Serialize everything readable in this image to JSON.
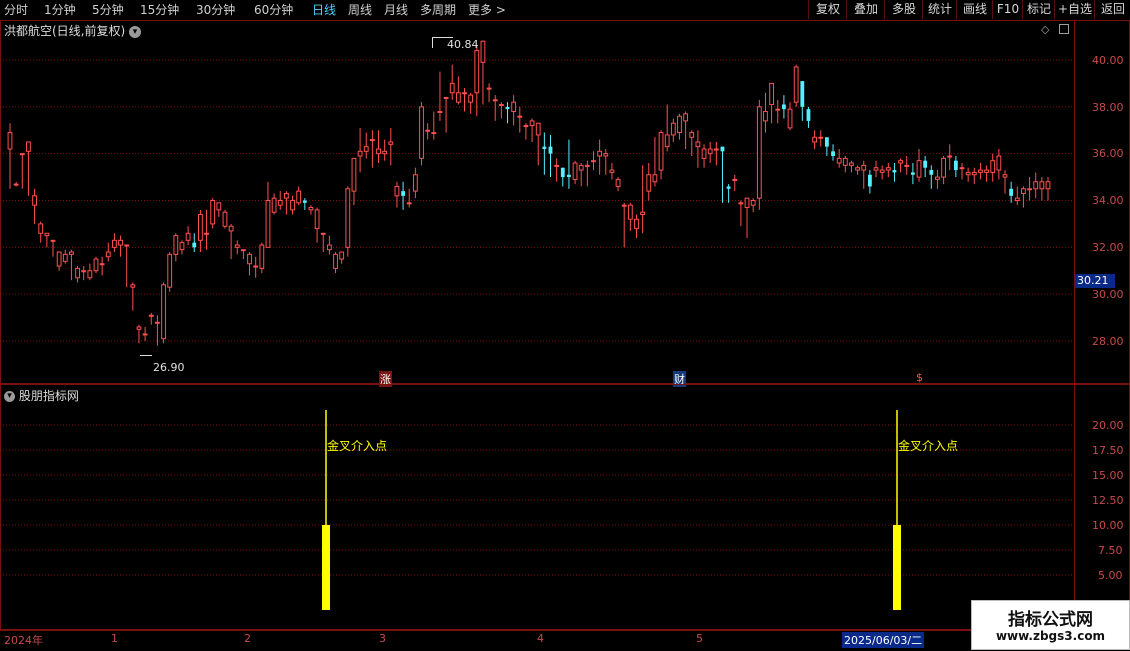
{
  "toolbar": {
    "periods": [
      "分时",
      "1分钟",
      "5分钟",
      "15分钟",
      "30分钟",
      "60分钟",
      "日线",
      "周线",
      "月线",
      "多周期",
      "更多 >"
    ],
    "active_period": "日线",
    "buttons": [
      "复权",
      "叠加",
      "多股",
      "统计",
      "画线",
      "F10",
      "标记",
      "+自选",
      "返回"
    ]
  },
  "main_panel": {
    "title": "洪都航空(日线,前复权)",
    "y_ticks": [
      "40.00",
      "38.00",
      "36.00",
      "34.00",
      "32.00",
      "30.00",
      "28.00"
    ],
    "high_label": "40.84",
    "low_label": "26.90",
    "current_price": "30.21",
    "event_marks": [
      "涨",
      "财",
      "$"
    ]
  },
  "indicator_panel": {
    "title": "股朋指标网",
    "y_ticks": [
      "20.00",
      "17.50",
      "15.00",
      "12.50",
      "10.00",
      "7.50",
      "5.00"
    ],
    "signal_label": "金叉介入点",
    "signals": [
      {
        "label": "金叉介入点"
      },
      {
        "label": "金叉介入点"
      }
    ]
  },
  "x_axis": {
    "labels": [
      "2024年",
      "1",
      "2",
      "3",
      "4",
      "5",
      "6"
    ],
    "cursor_date": "2025/06/03/二"
  },
  "watermark": {
    "title": "指标公式网",
    "url": "www.zbgs3.com"
  },
  "colors": {
    "up": "#ff5050",
    "down": "#54f0ff",
    "signal": "#ffff00",
    "grid": "#7a1010"
  },
  "chart_data": {
    "type": "candlestick",
    "title": "洪都航空(日线,前复权)",
    "ylim": [
      27.0,
      41.0
    ],
    "y_ticks": [
      28,
      30,
      32,
      34,
      36,
      38,
      40
    ],
    "high": 40.84,
    "low": 26.9,
    "last": 30.21,
    "candles": [
      [
        36.2,
        36.9,
        36.0,
        37.3,
        34.5
      ],
      [
        34.7,
        34.7,
        34.5,
        34.8,
        34.6
      ],
      [
        36.0,
        36.0,
        34.5,
        36.0,
        34.5
      ],
      [
        36.1,
        36.5,
        35.6,
        36.5,
        34.2
      ],
      [
        33.8,
        34.2,
        33.2,
        34.5,
        33.0
      ],
      [
        32.6,
        33.0,
        32.3,
        33.1,
        32.2
      ],
      [
        32.5,
        32.6,
        32.3,
        32.6,
        32.0
      ],
      [
        32.3,
        32.3,
        31.7,
        32.3,
        31.6
      ],
      [
        31.2,
        31.8,
        31.1,
        31.8,
        31.0
      ],
      [
        31.4,
        31.7,
        31.4,
        31.9,
        31.3
      ],
      [
        31.7,
        31.8,
        30.6,
        31.9,
        30.6
      ],
      [
        30.7,
        31.1,
        30.7,
        31.2,
        30.5
      ],
      [
        31.0,
        31.0,
        30.7,
        31.2,
        30.6
      ],
      [
        30.7,
        31.0,
        30.7,
        31.3,
        30.6
      ],
      [
        31.0,
        31.5,
        31.0,
        31.6,
        30.9
      ],
      [
        31.3,
        31.3,
        31.0,
        31.6,
        30.8
      ],
      [
        31.6,
        31.8,
        31.6,
        32.2,
        31.4
      ],
      [
        32.0,
        32.3,
        32.0,
        32.6,
        31.8
      ],
      [
        32.1,
        32.3,
        31.7,
        32.5,
        31.6
      ],
      [
        32.1,
        32.1,
        30.6,
        32.1,
        30.3
      ],
      [
        30.3,
        30.4,
        29.3,
        30.5,
        29.3
      ],
      [
        28.5,
        28.6,
        28.1,
        28.7,
        27.9
      ],
      [
        28.3,
        28.3,
        28.1,
        28.6,
        28.0
      ],
      [
        29.1,
        29.1,
        28.8,
        29.2,
        28.7
      ],
      [
        28.8,
        28.8,
        28.1,
        29.1,
        27.8
      ],
      [
        28.1,
        30.4,
        28.0,
        30.5,
        27.9
      ],
      [
        30.3,
        31.7,
        30.3,
        31.8,
        30.1
      ],
      [
        31.7,
        32.5,
        31.7,
        32.6,
        31.4
      ],
      [
        31.9,
        32.2,
        31.9,
        32.3,
        31.7
      ],
      [
        32.3,
        32.6,
        32.3,
        32.9,
        32.1
      ],
      [
        32.2,
        32.0,
        31.8,
        32.6,
        31.8
      ],
      [
        32.3,
        33.4,
        32.2,
        33.6,
        31.8
      ],
      [
        32.6,
        32.6,
        31.9,
        33.6,
        31.9
      ],
      [
        33.0,
        34.0,
        33.0,
        34.1,
        32.8
      ],
      [
        33.6,
        33.9,
        33.4,
        33.9,
        33.3
      ],
      [
        32.9,
        33.5,
        32.9,
        33.6,
        32.8
      ],
      [
        32.7,
        32.9,
        31.9,
        33.0,
        31.5
      ],
      [
        32.0,
        32.1,
        31.8,
        32.3,
        31.7
      ],
      [
        31.9,
        31.9,
        31.6,
        31.9,
        31.5
      ],
      [
        31.3,
        31.7,
        31.1,
        31.8,
        30.8
      ],
      [
        31.2,
        31.2,
        30.8,
        31.6,
        30.7
      ],
      [
        31.1,
        32.1,
        30.9,
        32.2,
        30.9
      ],
      [
        32.0,
        34.0,
        32.0,
        34.8,
        32.0
      ],
      [
        33.5,
        34.1,
        33.5,
        34.3,
        33.4
      ],
      [
        33.8,
        34.0,
        33.8,
        34.4,
        33.6
      ],
      [
        34.1,
        34.3,
        33.4,
        34.4,
        33.4
      ],
      [
        33.6,
        34.0,
        33.6,
        34.2,
        33.4
      ],
      [
        33.9,
        34.4,
        33.8,
        34.6,
        33.8
      ],
      [
        34.0,
        33.9,
        33.8,
        34.1,
        33.6
      ],
      [
        33.6,
        33.7,
        33.5,
        33.8,
        33.4
      ],
      [
        32.8,
        33.6,
        32.4,
        33.7,
        32.2
      ],
      [
        32.6,
        32.6,
        31.9,
        32.6,
        31.8
      ],
      [
        31.9,
        32.1,
        31.8,
        32.5,
        31.7
      ],
      [
        31.1,
        31.7,
        31.1,
        31.8,
        30.9
      ],
      [
        31.5,
        31.8,
        31.4,
        31.8,
        31.3
      ],
      [
        32.0,
        34.5,
        31.9,
        34.6,
        31.6
      ],
      [
        34.4,
        35.8,
        34.0,
        35.8,
        33.8
      ],
      [
        35.9,
        36.1,
        35.9,
        37.1,
        35.2
      ],
      [
        36.1,
        36.3,
        36.1,
        36.9,
        35.8
      ],
      [
        36.6,
        36.6,
        35.6,
        37.0,
        35.4
      ],
      [
        36.0,
        36.2,
        35.9,
        37.0,
        35.6
      ],
      [
        36.0,
        36.1,
        35.9,
        36.6,
        35.7
      ],
      [
        36.4,
        36.5,
        35.6,
        37.1,
        35.5
      ],
      [
        34.2,
        34.6,
        34.2,
        34.8,
        33.7
      ],
      [
        34.4,
        34.2,
        33.7,
        34.8,
        33.6
      ],
      [
        33.9,
        33.9,
        33.9,
        34.5,
        33.7
      ],
      [
        34.4,
        35.1,
        34.2,
        35.4,
        34.1
      ],
      [
        35.8,
        38.0,
        35.8,
        38.2,
        35.5
      ],
      [
        37.0,
        37.0,
        36.9,
        37.3,
        36.6
      ],
      [
        36.9,
        36.9,
        36.6,
        37.8,
        36.6
      ],
      [
        37.8,
        37.8,
        37.5,
        39.5,
        37.4
      ],
      [
        38.4,
        38.4,
        37.0,
        38.4,
        36.9
      ],
      [
        38.6,
        39.0,
        38.6,
        39.8,
        38.3
      ],
      [
        38.2,
        38.6,
        38.2,
        39.3,
        38.1
      ],
      [
        38.6,
        38.6,
        37.8,
        38.8,
        37.8
      ],
      [
        38.2,
        38.5,
        38.1,
        38.6,
        37.7
      ],
      [
        38.6,
        40.4,
        38.5,
        40.6,
        37.6
      ],
      [
        39.9,
        40.8,
        38.6,
        40.84,
        38.1
      ],
      [
        38.8,
        38.8,
        38.5,
        39.0,
        38.2
      ],
      [
        38.3,
        38.3,
        37.8,
        38.5,
        37.4
      ],
      [
        38.1,
        38.1,
        37.9,
        38.2,
        37.5
      ],
      [
        38.0,
        37.9,
        37.4,
        38.2,
        37.3
      ],
      [
        37.8,
        38.2,
        37.6,
        38.5,
        37.2
      ],
      [
        37.6,
        37.6,
        37.1,
        38.0,
        36.9
      ],
      [
        37.2,
        37.2,
        36.7,
        37.3,
        36.6
      ],
      [
        37.2,
        37.4,
        36.9,
        37.5,
        36.5
      ],
      [
        36.8,
        37.3,
        36.6,
        37.3,
        35.5
      ],
      [
        36.3,
        36.2,
        36.0,
        36.9,
        35.1
      ],
      [
        36.3,
        36.0,
        35.1,
        36.8,
        35.0
      ],
      [
        35.5,
        35.5,
        35.0,
        35.8,
        34.8
      ],
      [
        35.4,
        35.0,
        34.8,
        35.4,
        34.6
      ],
      [
        35.1,
        35.0,
        34.7,
        36.6,
        34.5
      ],
      [
        34.9,
        35.6,
        34.7,
        35.7,
        34.7
      ],
      [
        35.3,
        35.5,
        34.8,
        35.6,
        34.6
      ],
      [
        35.5,
        35.5,
        34.8,
        35.7,
        34.6
      ],
      [
        35.7,
        35.7,
        35.4,
        36.1,
        35.3
      ],
      [
        35.9,
        36.1,
        35.8,
        36.6,
        35.1
      ],
      [
        35.9,
        36.0,
        35.5,
        36.2,
        35.1
      ],
      [
        35.2,
        35.3,
        35.1,
        35.6,
        34.9
      ],
      [
        34.6,
        34.9,
        34.5,
        35.0,
        34.4
      ],
      [
        33.8,
        33.8,
        32.4,
        33.9,
        32.0
      ],
      [
        33.2,
        33.8,
        32.9,
        33.9,
        32.7
      ],
      [
        32.8,
        33.2,
        32.6,
        33.4,
        32.4
      ],
      [
        33.4,
        33.5,
        33.2,
        35.5,
        32.6
      ],
      [
        34.4,
        35.1,
        34.3,
        35.6,
        34.0
      ],
      [
        34.8,
        35.1,
        34.8,
        36.7,
        34.6
      ],
      [
        35.3,
        36.9,
        35.3,
        37.0,
        34.9
      ],
      [
        36.3,
        36.8,
        36.2,
        38.1,
        36.1
      ],
      [
        36.8,
        37.3,
        36.7,
        37.5,
        36.5
      ],
      [
        36.9,
        37.6,
        36.8,
        37.7,
        36.6
      ],
      [
        37.4,
        37.7,
        36.9,
        37.8,
        36.2
      ],
      [
        36.7,
        36.9,
        36.4,
        37.0,
        35.9
      ],
      [
        36.3,
        36.5,
        35.6,
        37.0,
        35.4
      ],
      [
        35.8,
        36.2,
        35.8,
        36.4,
        35.4
      ],
      [
        36.0,
        36.2,
        35.9,
        36.5,
        35.6
      ],
      [
        36.2,
        36.2,
        35.6,
        36.5,
        35.5
      ],
      [
        36.3,
        36.1,
        34.0,
        36.3,
        33.9
      ],
      [
        34.6,
        34.5,
        34.2,
        34.7,
        33.9
      ],
      [
        34.9,
        34.9,
        34.6,
        35.1,
        34.4
      ],
      [
        33.9,
        33.9,
        33.0,
        34.0,
        32.9
      ],
      [
        33.7,
        34.1,
        33.6,
        34.1,
        32.4
      ],
      [
        33.8,
        34.0,
        33.7,
        34.1,
        33.5
      ],
      [
        34.1,
        38.0,
        34.1,
        38.3,
        33.6
      ],
      [
        37.4,
        37.8,
        37.1,
        38.6,
        36.9
      ],
      [
        38.1,
        39.0,
        37.6,
        39.0,
        37.3
      ],
      [
        37.9,
        37.9,
        37.8,
        38.3,
        37.3
      ],
      [
        38.1,
        37.9,
        37.6,
        38.5,
        37.5
      ],
      [
        37.1,
        37.9,
        37.1,
        38.2,
        37.0
      ],
      [
        38.2,
        39.7,
        38.1,
        39.8,
        38.0
      ],
      [
        39.1,
        38.0,
        37.5,
        39.1,
        37.4
      ],
      [
        37.9,
        37.4,
        37.2,
        38.0,
        37.1
      ],
      [
        36.5,
        36.7,
        36.3,
        37.0,
        36.2
      ],
      [
        36.7,
        36.7,
        36.5,
        37.0,
        36.3
      ],
      [
        36.7,
        36.3,
        36.0,
        36.7,
        35.9
      ],
      [
        36.1,
        35.9,
        35.9,
        36.4,
        35.7
      ],
      [
        35.6,
        35.8,
        35.6,
        36.2,
        35.4
      ],
      [
        35.5,
        35.8,
        35.4,
        35.9,
        35.2
      ],
      [
        35.5,
        35.6,
        35.3,
        35.7,
        35.2
      ],
      [
        35.3,
        35.4,
        35.2,
        35.5,
        35.1
      ],
      [
        35.3,
        35.5,
        34.6,
        35.7,
        34.5
      ],
      [
        35.1,
        34.6,
        34.4,
        35.3,
        34.3
      ],
      [
        35.3,
        35.4,
        35.1,
        35.7,
        35.0
      ],
      [
        35.2,
        35.3,
        35.0,
        35.5,
        34.9
      ],
      [
        35.3,
        35.4,
        35.1,
        35.6,
        35.0
      ],
      [
        35.3,
        35.2,
        34.9,
        35.6,
        34.8
      ],
      [
        35.6,
        35.7,
        35.4,
        35.8,
        35.2
      ],
      [
        35.5,
        35.5,
        35.3,
        35.9,
        35.1
      ],
      [
        35.2,
        35.1,
        34.8,
        35.6,
        34.7
      ],
      [
        35.0,
        35.7,
        34.9,
        36.2,
        34.8
      ],
      [
        35.7,
        35.4,
        35.2,
        35.9,
        35.0
      ],
      [
        35.3,
        35.1,
        34.6,
        35.5,
        34.5
      ],
      [
        34.9,
        35.0,
        34.6,
        35.3,
        34.5
      ],
      [
        35.0,
        35.8,
        34.8,
        35.9,
        34.7
      ],
      [
        35.9,
        35.9,
        35.5,
        36.4,
        35.3
      ],
      [
        35.7,
        35.3,
        35.2,
        35.9,
        35.0
      ],
      [
        35.4,
        35.4,
        35.1,
        35.6,
        34.9
      ],
      [
        35.1,
        35.2,
        34.9,
        35.4,
        34.8
      ],
      [
        35.1,
        35.2,
        34.9,
        35.4,
        34.7
      ],
      [
        35.2,
        35.3,
        35.0,
        35.6,
        34.9
      ],
      [
        35.2,
        35.3,
        34.9,
        35.5,
        34.8
      ],
      [
        35.2,
        35.7,
        34.9,
        36.0,
        34.8
      ],
      [
        35.3,
        35.9,
        35.1,
        36.2,
        34.9
      ],
      [
        35.0,
        35.1,
        34.5,
        35.3,
        34.3
      ],
      [
        34.5,
        34.2,
        34.1,
        34.8,
        33.9
      ],
      [
        34.0,
        34.1,
        33.9,
        34.6,
        33.8
      ],
      [
        34.3,
        34.5,
        33.9,
        34.6,
        33.7
      ],
      [
        34.5,
        34.5,
        34.3,
        35.0,
        34.0
      ],
      [
        34.5,
        34.8,
        34.2,
        35.2,
        34.1
      ],
      [
        34.5,
        34.8,
        34.2,
        35.0,
        34.0
      ],
      [
        34.5,
        34.8,
        34.2,
        35.0,
        34.0
      ]
    ],
    "indicator": {
      "ylim": [
        0,
        22
      ],
      "y_ticks": [
        20,
        17.5,
        15,
        12.5,
        10,
        7.5,
        5
      ],
      "spike_value": 21.5
    }
  }
}
